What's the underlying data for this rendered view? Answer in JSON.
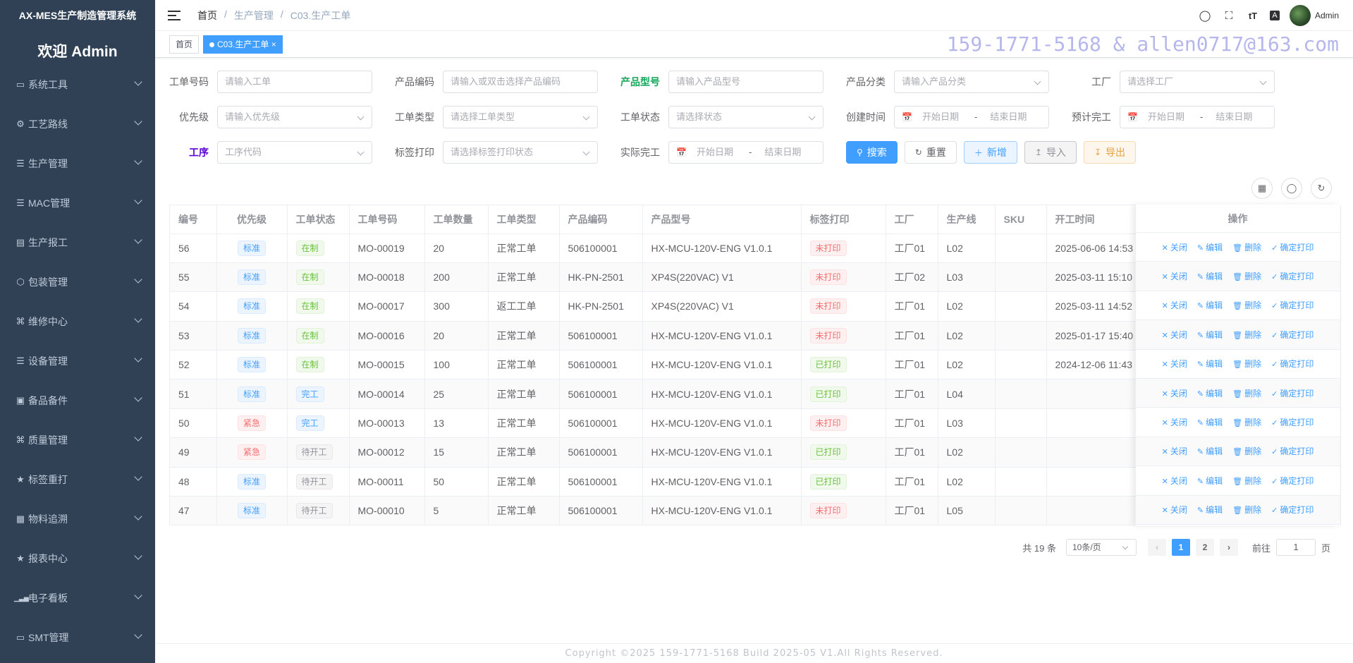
{
  "app": {
    "title": "AX-MES生产制造管理系统",
    "welcome": "欢迎 Admin"
  },
  "sidebar": {
    "items": [
      {
        "label": "系统工具",
        "icon": "monitor-icon"
      },
      {
        "label": "工艺路线",
        "icon": "gear-icon"
      },
      {
        "label": "生产管理",
        "icon": "list-icon"
      },
      {
        "label": "MAC管理",
        "icon": "list-icon"
      },
      {
        "label": "生产报工",
        "icon": "chart-icon"
      },
      {
        "label": "包装管理",
        "icon": "package-icon"
      },
      {
        "label": "维修中心",
        "icon": "grid-icon"
      },
      {
        "label": "设备管理",
        "icon": "list-icon"
      },
      {
        "label": "备品备件",
        "icon": "lock-icon"
      },
      {
        "label": "质量管理",
        "icon": "grid-icon"
      },
      {
        "label": "标签重打",
        "icon": "star-icon"
      },
      {
        "label": "物料追溯",
        "icon": "table-icon"
      },
      {
        "label": "报表中心",
        "icon": "star-icon"
      },
      {
        "label": "电子看板",
        "icon": "bar-chart-icon"
      },
      {
        "label": "SMT管理",
        "icon": "monitor-icon"
      }
    ]
  },
  "navbar": {
    "breadcrumb": [
      "首页",
      "/",
      "生产管理",
      "/",
      "C03.生产工单"
    ],
    "user": "Admin"
  },
  "tags": {
    "home": "首页",
    "active": "C03.生产工单",
    "close": "×"
  },
  "watermark": "159-1771-5168 & allen0717@163.com",
  "filters": {
    "order_no": {
      "label": "工单号码",
      "placeholder": "请输入工单"
    },
    "product_code": {
      "label": "产品编码",
      "placeholder": "请输入或双击选择产品编码"
    },
    "product_model": {
      "label": "产品型号",
      "placeholder": "请输入产品型号"
    },
    "product_category": {
      "label": "产品分类",
      "placeholder": "请输入产品分类"
    },
    "factory": {
      "label": "工厂",
      "placeholder": "请选择工厂"
    },
    "priority": {
      "label": "优先级",
      "placeholder": "请输入优先级"
    },
    "order_type": {
      "label": "工单类型",
      "placeholder": "请选择工单类型"
    },
    "order_status": {
      "label": "工单状态",
      "placeholder": "请选择状态"
    },
    "created": {
      "label": "创建时间",
      "start": "开始日期",
      "sep": "-",
      "end": "结束日期"
    },
    "planned_finish": {
      "label": "预计完工",
      "start": "开始日期",
      "sep": "-",
      "end": "结束日期"
    },
    "process": {
      "label": "工序",
      "placeholder": "工序代码"
    },
    "label_print": {
      "label": "标签打印",
      "placeholder": "请选择标签打印状态"
    },
    "actual_finish": {
      "label": "实际完工",
      "start": "开始日期",
      "sep": "-",
      "end": "结束日期"
    }
  },
  "buttons": {
    "search": "搜索",
    "reset": "重置",
    "add": "新增",
    "import": "导入",
    "export": "导出"
  },
  "table": {
    "columns": [
      "编号",
      "优先级",
      "工单状态",
      "工单号码",
      "工单数量",
      "工单类型",
      "产品编码",
      "产品型号",
      "标签打印",
      "工厂",
      "生产线",
      "SKU",
      "开工时间"
    ],
    "ops_header": "操作",
    "ops": [
      "关闭",
      "编辑",
      "删除",
      "确定打印"
    ],
    "rows": [
      {
        "id": "56",
        "priority": "标准",
        "pri_type": "info",
        "status": "在制",
        "st_type": "success",
        "order": "MO-00019",
        "qty": "20",
        "type": "正常工单",
        "code": "506100001",
        "model": "HX-MCU-120V-ENG V1.0.1",
        "print": "未打印",
        "pr_type": "danger",
        "factory": "工厂01",
        "line": "L02",
        "sku": "",
        "start": "2025-06-06 14:53"
      },
      {
        "id": "55",
        "priority": "标准",
        "pri_type": "info",
        "status": "在制",
        "st_type": "success",
        "order": "MO-00018",
        "qty": "200",
        "type": "正常工单",
        "code": "HK-PN-2501",
        "model": "XP4S(220VAC) V1",
        "print": "未打印",
        "pr_type": "danger",
        "factory": "工厂02",
        "line": "L03",
        "sku": "",
        "start": "2025-03-11 15:10"
      },
      {
        "id": "54",
        "priority": "标准",
        "pri_type": "info",
        "status": "在制",
        "st_type": "success",
        "order": "MO-00017",
        "qty": "300",
        "type": "返工工单",
        "code": "HK-PN-2501",
        "model": "XP4S(220VAC) V1",
        "print": "未打印",
        "pr_type": "danger",
        "factory": "工厂01",
        "line": "L02",
        "sku": "",
        "start": "2025-03-11 14:52"
      },
      {
        "id": "53",
        "priority": "标准",
        "pri_type": "info",
        "status": "在制",
        "st_type": "success",
        "order": "MO-00016",
        "qty": "20",
        "type": "正常工单",
        "code": "506100001",
        "model": "HX-MCU-120V-ENG V1.0.1",
        "print": "未打印",
        "pr_type": "danger",
        "factory": "工厂01",
        "line": "L02",
        "sku": "",
        "start": "2025-01-17 15:40"
      },
      {
        "id": "52",
        "priority": "标准",
        "pri_type": "info",
        "status": "在制",
        "st_type": "success",
        "order": "MO-00015",
        "qty": "100",
        "type": "正常工单",
        "code": "506100001",
        "model": "HX-MCU-120V-ENG V1.0.1",
        "print": "已打印",
        "pr_type": "success",
        "factory": "工厂01",
        "line": "L02",
        "sku": "",
        "start": "2024-12-06 11:43"
      },
      {
        "id": "51",
        "priority": "标准",
        "pri_type": "info",
        "status": "完工",
        "st_type": "info",
        "order": "MO-00014",
        "qty": "25",
        "type": "正常工单",
        "code": "506100001",
        "model": "HX-MCU-120V-ENG V1.0.1",
        "print": "已打印",
        "pr_type": "success",
        "factory": "工厂01",
        "line": "L04",
        "sku": "",
        "start": ""
      },
      {
        "id": "50",
        "priority": "紧急",
        "pri_type": "danger",
        "status": "完工",
        "st_type": "info",
        "order": "MO-00013",
        "qty": "13",
        "type": "正常工单",
        "code": "506100001",
        "model": "HX-MCU-120V-ENG V1.0.1",
        "print": "未打印",
        "pr_type": "danger",
        "factory": "工厂01",
        "line": "L03",
        "sku": "",
        "start": ""
      },
      {
        "id": "49",
        "priority": "紧急",
        "pri_type": "danger",
        "status": "待开工",
        "st_type": "default",
        "order": "MO-00012",
        "qty": "15",
        "type": "正常工单",
        "code": "506100001",
        "model": "HX-MCU-120V-ENG V1.0.1",
        "print": "已打印",
        "pr_type": "success",
        "factory": "工厂01",
        "line": "L02",
        "sku": "",
        "start": ""
      },
      {
        "id": "48",
        "priority": "标准",
        "pri_type": "info",
        "status": "待开工",
        "st_type": "default",
        "order": "MO-00011",
        "qty": "50",
        "type": "正常工单",
        "code": "506100001",
        "model": "HX-MCU-120V-ENG V1.0.1",
        "print": "已打印",
        "pr_type": "success",
        "factory": "工厂01",
        "line": "L02",
        "sku": "",
        "start": ""
      },
      {
        "id": "47",
        "priority": "标准",
        "pri_type": "info",
        "status": "待开工",
        "st_type": "default",
        "order": "MO-00010",
        "qty": "5",
        "type": "正常工单",
        "code": "506100001",
        "model": "HX-MCU-120V-ENG V1.0.1",
        "print": "未打印",
        "pr_type": "danger",
        "factory": "工厂01",
        "line": "L05",
        "sku": "",
        "start": ""
      }
    ]
  },
  "pagination": {
    "total": "共 19 条",
    "page_size": "10条/页",
    "pages": [
      "1",
      "2"
    ],
    "current": "1",
    "goto_label": "前往",
    "goto_value": "1",
    "page_suffix": "页"
  },
  "footer": "Copyright ©2025 159-1771-5168 Build 2025-05 V1.All Rights Reserved.",
  "colors": {
    "sidebar_bg": "#304156",
    "primary": "#409eff",
    "success": "#67c23a",
    "danger": "#f56c6c",
    "warning": "#e6a23c"
  }
}
